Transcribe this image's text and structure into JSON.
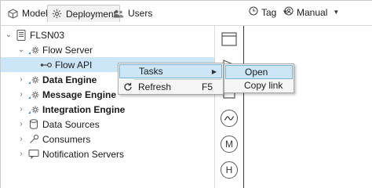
{
  "tabs": [
    {
      "label": "Model",
      "icon": "cube-icon"
    },
    {
      "label": "Deployment",
      "icon": "gear-icon"
    },
    {
      "label": "Users",
      "icon": "users-icon"
    }
  ],
  "toolbar": {
    "tag_label": "Tag",
    "manual_label": "Manual"
  },
  "tree": {
    "root": "FLSN03",
    "flow_server": "Flow Server",
    "flow_api": "Flow API",
    "data_engine": "Data Engine",
    "message_engine": "Message Engine",
    "integration_engine": "Integration Engine",
    "data_sources": "Data Sources",
    "consumers": "Consumers",
    "notification_servers": "Notification Servers"
  },
  "context_menu": {
    "tasks": "Tasks",
    "refresh": "Refresh",
    "refresh_shortcut": "F5"
  },
  "submenu": {
    "open": "Open",
    "copy_link": "Copy link"
  },
  "palette": {
    "m_label": "M",
    "h_label": "H"
  },
  "colors": {
    "selection": "#cde6f7",
    "highlight_border": "#7ab3da",
    "menu_bg": "#f5f5f5"
  }
}
